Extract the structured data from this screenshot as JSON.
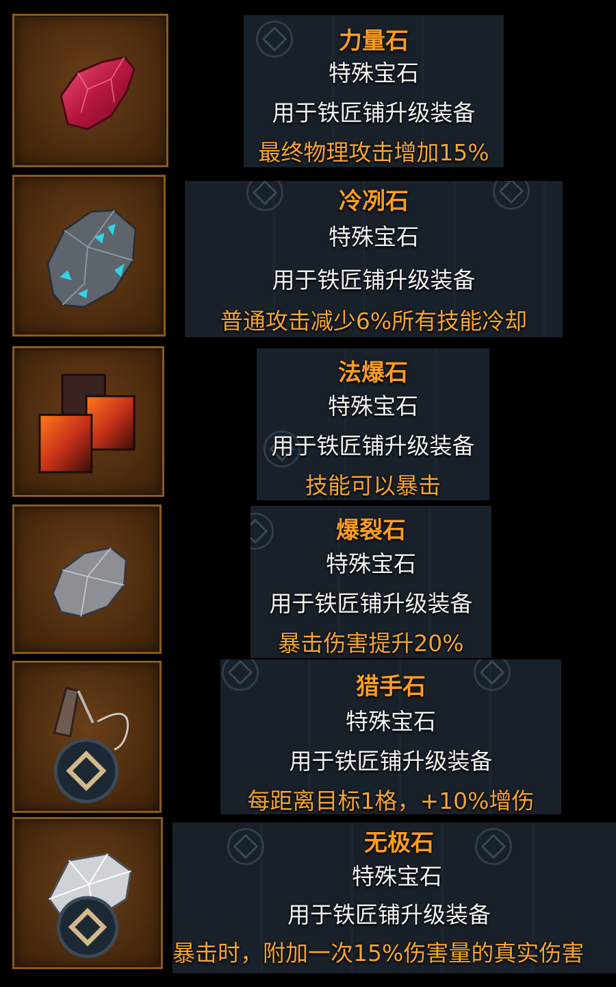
{
  "items": [
    {
      "name": "力量石",
      "type": "特殊宝石",
      "usage": "用于铁匠铺升级装备",
      "effect": "最终物理攻击增加15%",
      "icon": "red-gem-icon"
    },
    {
      "name": "冷冽石",
      "type": "特殊宝石",
      "usage": "用于铁匠铺升级装备",
      "effect": "普通攻击减少6%所有技能冷却",
      "icon": "frost-stone-icon"
    },
    {
      "name": "法爆石",
      "type": "特殊宝石",
      "usage": "用于铁匠铺升级装备",
      "effect": "技能可以暴击",
      "icon": "lava-cubes-icon"
    },
    {
      "name": "爆裂石",
      "type": "特殊宝石",
      "usage": "用于铁匠铺升级装备",
      "effect": "暴击伤害提升20%",
      "icon": "grey-stone-icon"
    },
    {
      "name": "猎手石",
      "type": "特殊宝石",
      "usage": "用于铁匠铺升级装备",
      "effect": "每距离目标1格，+10%增伤",
      "icon": "hunter-pendant-icon"
    },
    {
      "name": "无极石",
      "type": "特殊宝石",
      "usage": "用于铁匠铺升级装备",
      "effect": "暴击时，附加一次15%伤害量的真实伤害",
      "icon": "silver-crystal-icon"
    }
  ],
  "colors": {
    "name": "#ff9d1f",
    "text": "#f2f2f2",
    "effect": "#f5a531",
    "slot_bg": "#4d2c0f",
    "slot_border": "#8a5a22"
  }
}
